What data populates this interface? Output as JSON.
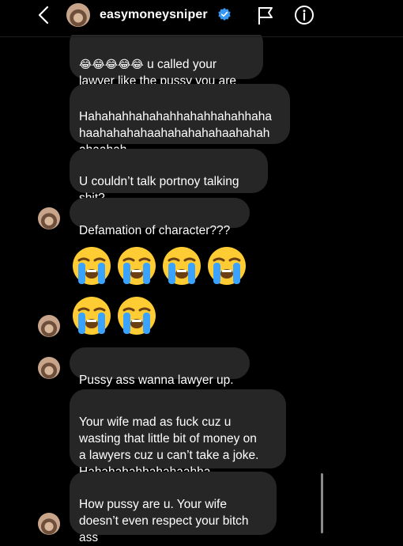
{
  "header": {
    "username": "easymoneysniper",
    "icons": [
      "back-chevron-icon",
      "verified-badge-icon",
      "report-flag-icon",
      "info-icon"
    ],
    "accent_color": "#3897f0"
  },
  "messages": [
    {
      "emoji_prefix": "😂😂😂😂😂",
      "text": " u called your\nlawyer like  the pussy you are"
    },
    {
      "text": "Hahahahhahahahhahahhahahhaha\nhaahahahahaahahahahahaahahah\nahaahah"
    },
    {
      "text": "U couldn’t talk portnoy talking\nshit?"
    },
    {
      "text": "Defamation of character???"
    },
    {
      "emoji_row": [
        "😭",
        "😭",
        "😭",
        "😭",
        "😭",
        "😭"
      ]
    },
    {
      "text": "Pussy ass wanna lawyer up."
    },
    {
      "text": "Your wife mad as fuck cuz u\nwasting that little bit of money on\na lawyers cuz u can’t take a joke.\nHahahahahhahahaahha"
    },
    {
      "text": "How pussy are u. Your wife\ndoesn’t even respect your bitch\nass"
    }
  ]
}
